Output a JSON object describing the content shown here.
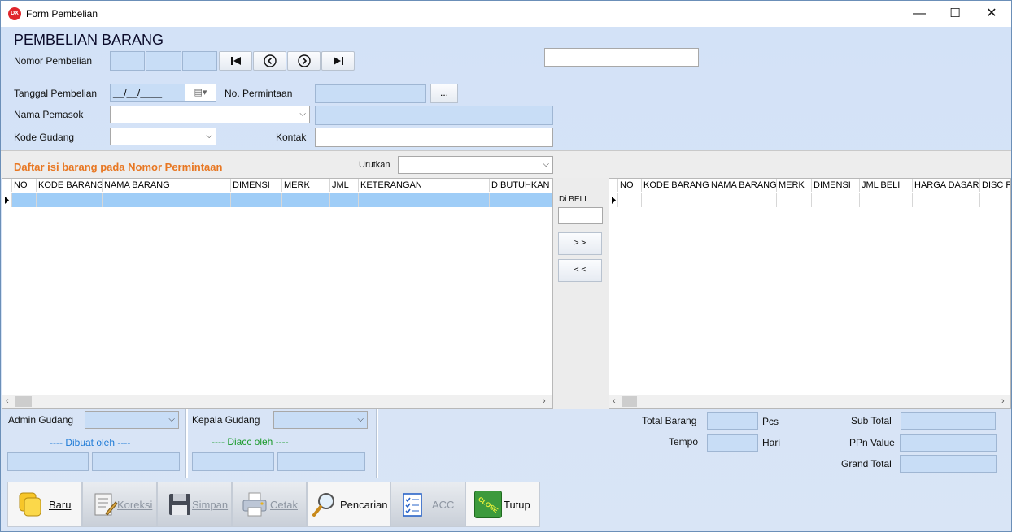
{
  "window": {
    "title": "Form Pembelian",
    "app_icon_text": "DX",
    "controls": {
      "minimize": "—",
      "maximize": "☐",
      "close": "✕"
    }
  },
  "header": {
    "heading": "PEMBELIAN BARANG",
    "nomor_label": "Nomor Pembelian",
    "nav": {
      "first": "⏮",
      "prev": "◀",
      "next": "▶",
      "last": "⏭"
    },
    "tanggal_label": "Tanggal Pembelian",
    "tanggal_value": "__/__/____",
    "permintaan_label": "No. Permintaan",
    "permintaan_button": "...",
    "pemasok_label": "Nama Pemasok",
    "gudang_label": "Kode Gudang",
    "kontak_label": "Kontak"
  },
  "list_band": {
    "title": "Daftar isi barang pada Nomor Permintaan",
    "sort_label": "Urutkan"
  },
  "left_grid": {
    "columns": [
      "NO",
      "KODE BARANG",
      "NAMA BARANG",
      "DIMENSI",
      "MERK",
      "JML",
      "KETERANGAN",
      "DIBUTUHKAN"
    ]
  },
  "transfer": {
    "label": "Di BELI",
    "add_button": "> >",
    "remove_button": "< <"
  },
  "right_grid": {
    "columns": [
      "NO",
      "KODE BARANG",
      "NAMA BARANG",
      "MERK",
      "DIMENSI",
      "JML BELI",
      "HARGA DASAR",
      "DISC RA"
    ]
  },
  "approval": {
    "admin_label": "Admin Gudang",
    "dibuat_label": "---- Dibuat oleh ----",
    "kepala_label": "Kepala Gudang",
    "diacc_label": "---- Diacc oleh ----"
  },
  "totals": {
    "total_barang_label": "Total Barang",
    "total_barang_unit": "Pcs",
    "tempo_label": "Tempo",
    "tempo_unit": "Hari",
    "subtotal_label": "Sub Total",
    "ppn_label": "PPn Value",
    "grand_total_label": "Grand Total"
  },
  "toolbar": {
    "baru": "Baru",
    "koreksi": "Koreksi",
    "simpan": "Simpan",
    "cetak": "Cetak",
    "pencarian": "Pencarian",
    "acc": "ACC",
    "tutup": "Tutup",
    "close_stamp": "CLOSE"
  },
  "colors": {
    "band_title": "#e87722",
    "dibuat_text": "#1e7ad6",
    "diacc_text": "#1a9a2a",
    "field_blue": "#c8ddf6"
  }
}
